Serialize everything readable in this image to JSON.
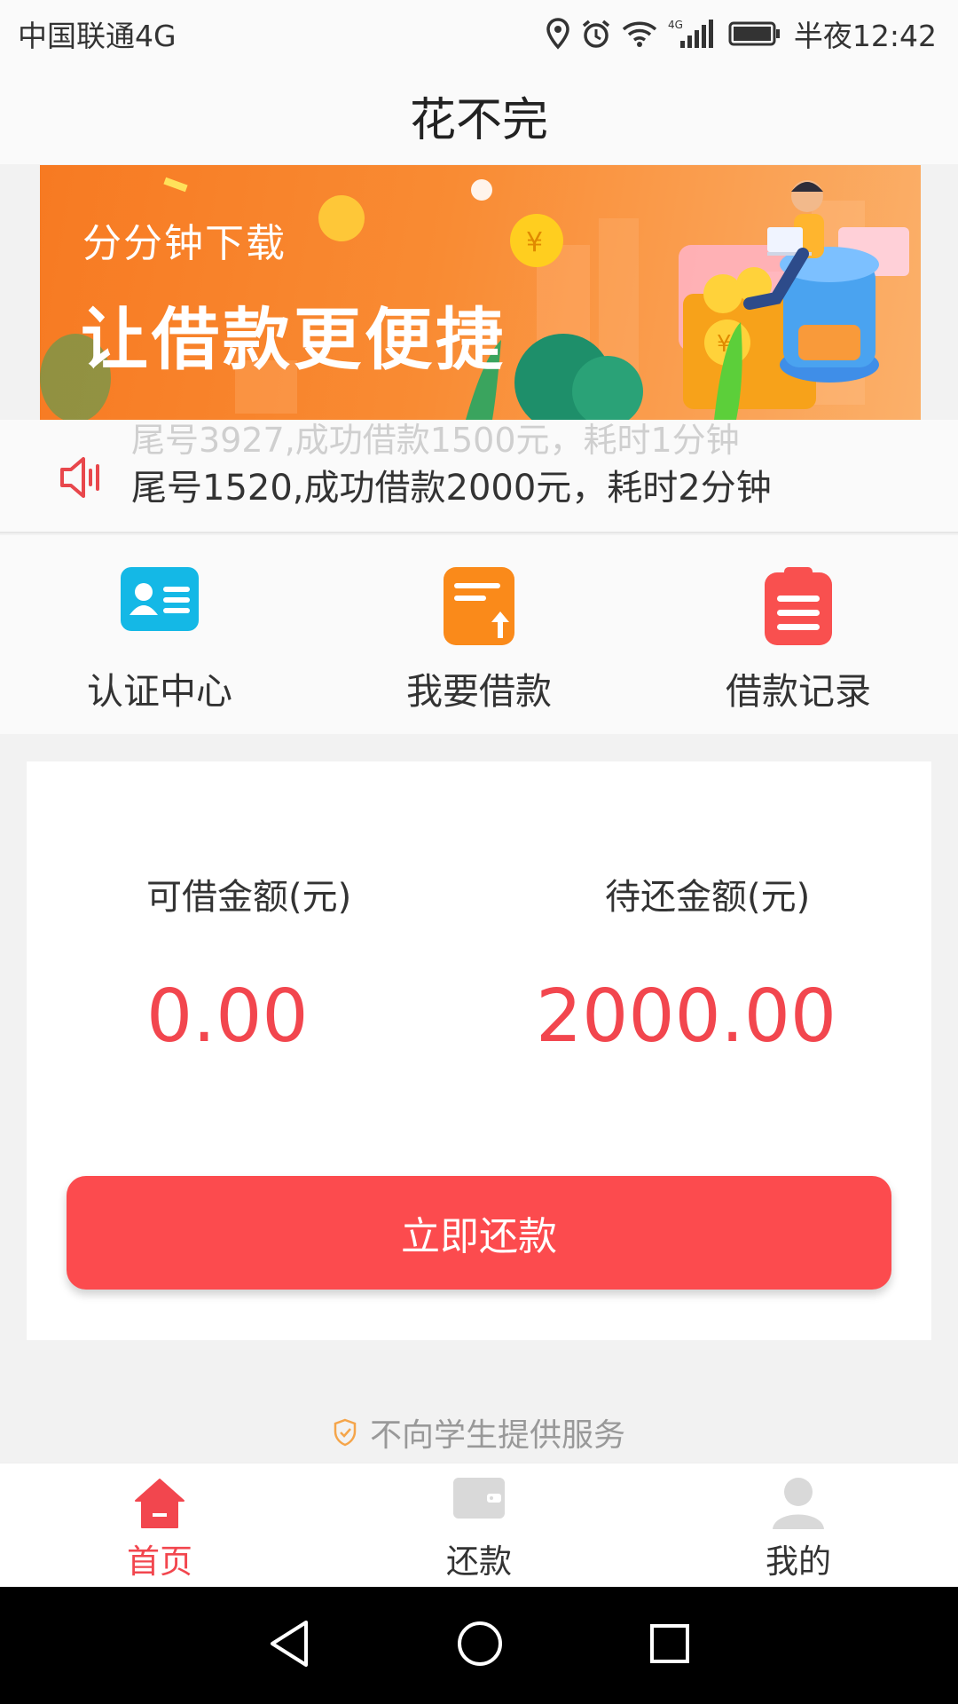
{
  "status_bar": {
    "carrier": "中国联通4G",
    "network_label": "4G",
    "time": "半夜12:42"
  },
  "header": {
    "title": "花不完"
  },
  "banner": {
    "subtitle": "分分钟下载",
    "headline": "让借款更便捷"
  },
  "notice": {
    "previous_text": "尾号3927,成功借款1500元，耗时1分钟",
    "current_text": "尾号1520,成功借款2000元，耗时2分钟"
  },
  "quick_menu": {
    "items": [
      {
        "label": "认证中心",
        "icon": "id-card-icon",
        "color": "#14b8e6"
      },
      {
        "label": "我要借款",
        "icon": "loan-document-icon",
        "color": "#fa8a1a"
      },
      {
        "label": "借款记录",
        "icon": "clipboard-list-icon",
        "color": "#f9504f"
      }
    ]
  },
  "account": {
    "available_label": "可借金额(元)",
    "available_value": "0.00",
    "pending_label": "待还金额(元)",
    "pending_value": "2000.00",
    "repay_button": "立即还款"
  },
  "footer": {
    "note": "不向学生提供服务"
  },
  "tab_bar": {
    "tabs": [
      {
        "label": "首页",
        "icon": "home-icon",
        "active": true
      },
      {
        "label": "还款",
        "icon": "wallet-icon",
        "active": false
      },
      {
        "label": "我的",
        "icon": "user-icon",
        "active": false
      }
    ]
  },
  "colors": {
    "accent": "#f2464e",
    "button": "#fc4b4e",
    "banner_orange": "#f77a22"
  }
}
